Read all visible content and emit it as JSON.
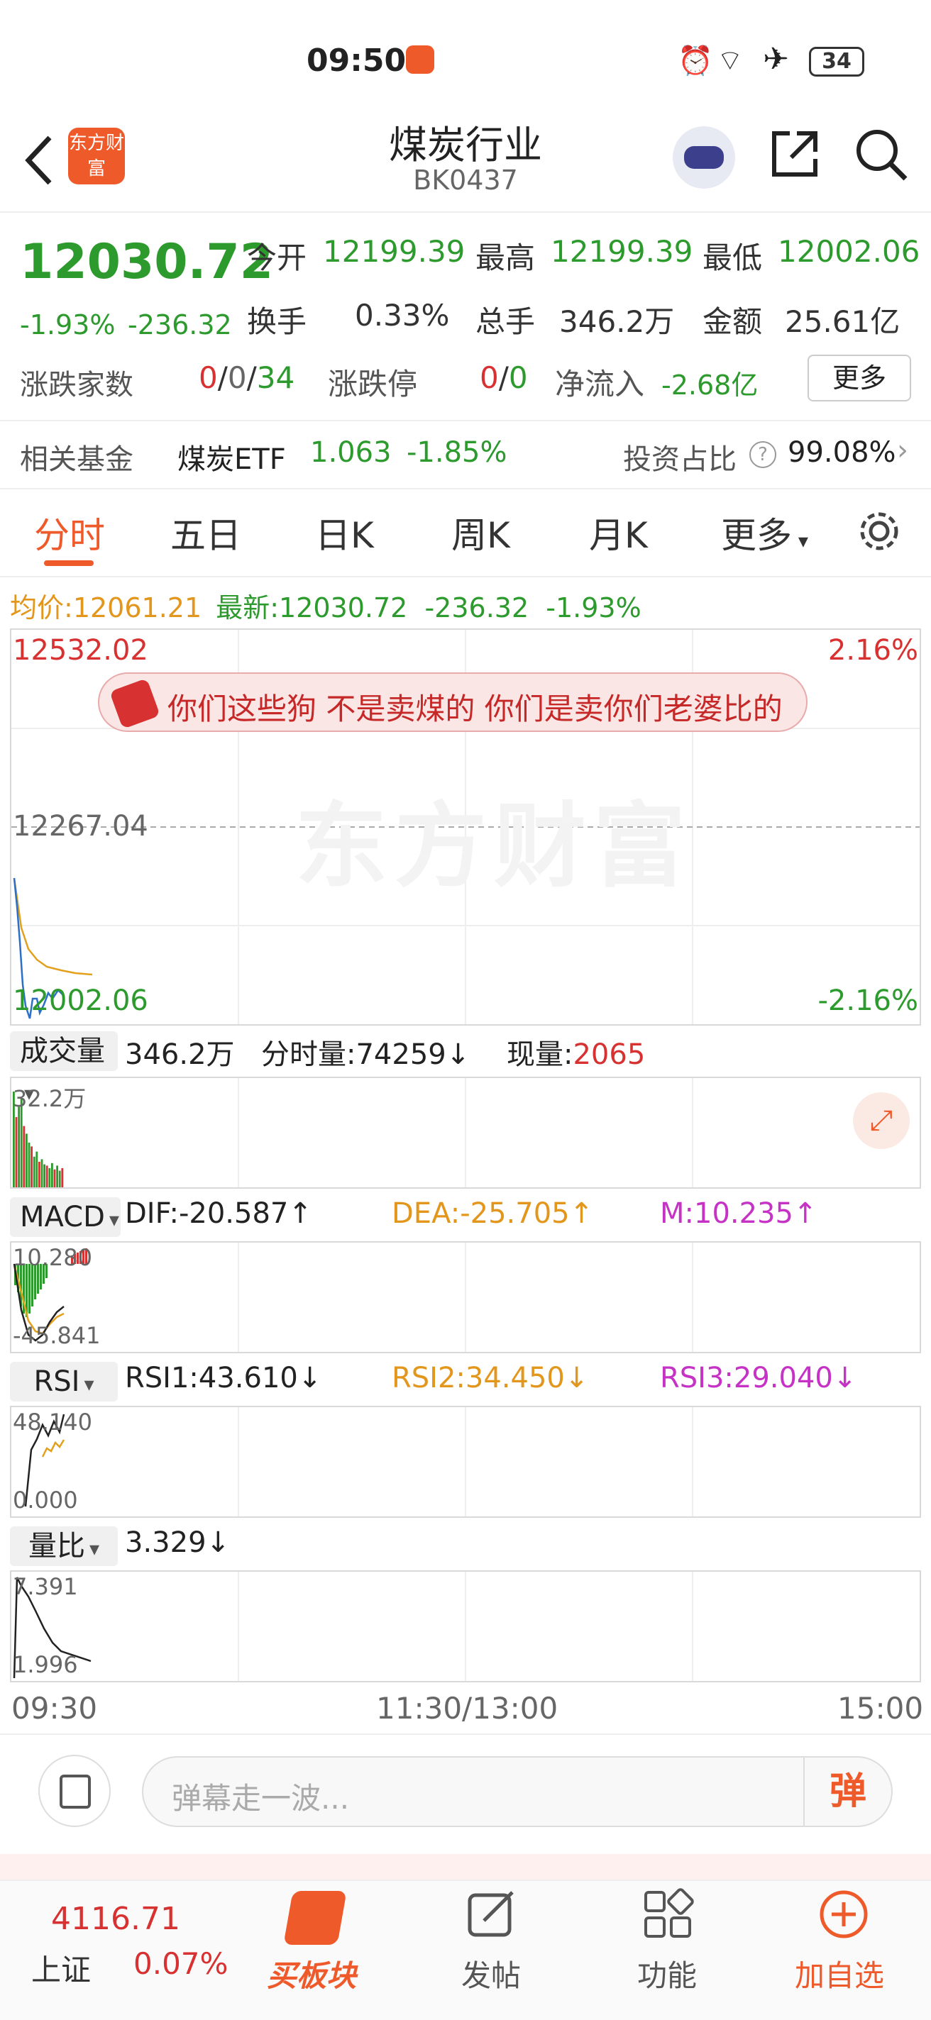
{
  "status_bar": {
    "time": "09:50",
    "battery": "34"
  },
  "header": {
    "title": "煤炭行业",
    "code": "BK0437",
    "logo_text": "东方财富"
  },
  "quote": {
    "price": "12030.72",
    "change_pct": "-1.93%",
    "change": "-236.32",
    "open_label": "今开",
    "open": "12199.39",
    "high_label": "最高",
    "high": "12199.39",
    "low_label": "最低",
    "low": "12002.06",
    "turnover_label": "换手",
    "turnover": "0.33%",
    "volume_label": "总手",
    "volume": "346.2万",
    "amount_label": "金额",
    "amount": "25.61亿",
    "updown_label": "涨跌家数",
    "up": "0",
    "flat": "0",
    "down": "34",
    "limit_label": "涨跌停",
    "limit_up": "0",
    "limit_down": "0",
    "netflow_label": "净流入",
    "netflow": "-2.68亿",
    "more_button": "更多"
  },
  "fund": {
    "label": "相关基金",
    "name": "煤炭ETF",
    "price": "1.063",
    "pct": "-1.85%",
    "ratio_label": "投资占比",
    "ratio": "99.08%"
  },
  "tabs": [
    "分时",
    "五日",
    "日K",
    "周K",
    "月K",
    "更多"
  ],
  "summary": {
    "avg_label": "均价:",
    "avg": "12061.21",
    "latest_label": "最新:",
    "latest": "12030.72",
    "change": "-236.32",
    "pct": "-1.93%"
  },
  "price_chart": {
    "top": "12532.02",
    "mid": "12267.04",
    "bottom": "12002.06",
    "top_pct": "2.16%",
    "bottom_pct": "-2.16%",
    "barrage": "你们这些狗 不是卖煤的 你们是卖你们老婆比的",
    "watermark": "东方财富"
  },
  "volume_panel": {
    "selector": "成交量",
    "total": "346.2万",
    "period_label": "分时量:",
    "period": "74259↓",
    "now_label": "现量:",
    "now": "2065",
    "scale": "32.2万"
  },
  "macd_panel": {
    "selector": "MACD",
    "dif": "DIF:-20.587↑",
    "dea": "DEA:-25.705↑",
    "m": "M:10.235↑",
    "top": "10.280",
    "bottom": "-45.841"
  },
  "rsi_panel": {
    "selector": "RSI",
    "rsi1": "RSI1:43.610↓",
    "rsi2": "RSI2:34.450↓",
    "rsi3": "RSI3:29.040↓",
    "top": "48.140",
    "bottom": "0.000"
  },
  "ratio_panel": {
    "selector": "量比",
    "value": "3.329↓",
    "top": "7.391",
    "bottom": "1.996"
  },
  "time_axis": {
    "start": "09:30",
    "mid": "11:30/13:00",
    "end": "15:00"
  },
  "comment": {
    "placeholder": "弹幕走一波...",
    "send": "弹"
  },
  "bottom_bar": {
    "index_value": "4116.71",
    "index_name": "上证",
    "index_pct": "0.07%",
    "items": [
      "买板块",
      "发帖",
      "功能",
      "加自选"
    ]
  }
}
